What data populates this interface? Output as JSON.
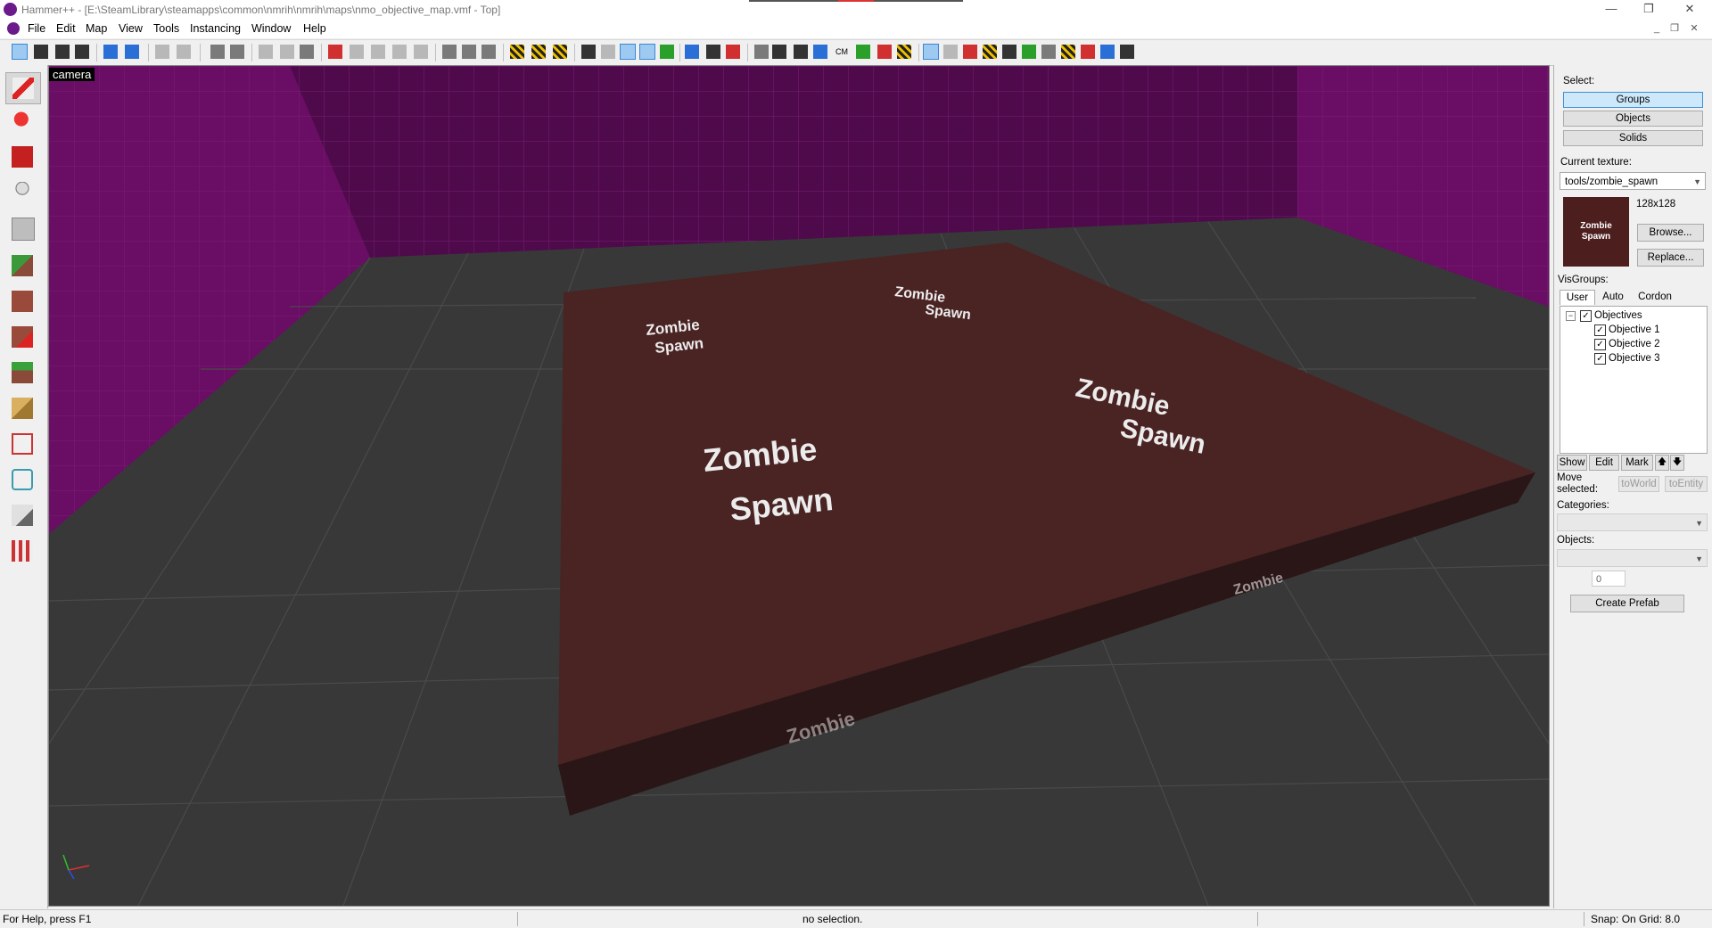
{
  "window": {
    "title": "Hammer++ - [E:\\SteamLibrary\\steamapps\\common\\nmrih\\nmrih\\maps\\nmo_objective_map.vmf - Top]",
    "minimize": "—",
    "restore": "❐",
    "close": "✕"
  },
  "menu": {
    "items": [
      "File",
      "Edit",
      "Map",
      "View",
      "Tools",
      "Instancing",
      "Window",
      "Help"
    ],
    "mdi_minimize": "_",
    "mdi_restore": "❐",
    "mdi_close": "✕"
  },
  "toolbar": {
    "cm_label": "CM"
  },
  "viewport": {
    "label": "camera",
    "decal_word_1": "Zombie",
    "decal_word_2": "Spawn",
    "side_word": "Zombie"
  },
  "panel": {
    "select_label": "Select:",
    "select_buttons": [
      "Groups",
      "Objects",
      "Solids"
    ],
    "current_texture_label": "Current texture:",
    "current_texture_value": "tools/zombie_spawn",
    "texture_size": "128x128",
    "browse_button": "Browse...",
    "replace_button": "Replace...",
    "texture_preview_line1": "Zombie",
    "texture_preview_line2": "Spawn",
    "visgroups_label": "VisGroups:",
    "tabs": [
      "User",
      "Auto",
      "Cordon"
    ],
    "tree_expander": "−",
    "tree": {
      "root": "Objectives",
      "children": [
        "Objective 1",
        "Objective 2",
        "Objective 3"
      ]
    },
    "check_mark": "✓",
    "show_button": "Show",
    "edit_button": "Edit",
    "mark_button": "Mark",
    "up_arrow": "🡅",
    "down_arrow": "🡇",
    "move_selected_label": "Move selected:",
    "to_world_button": "toWorld",
    "to_entity_button": "toEntity",
    "categories_label": "Categories:",
    "objects_label": "Objects:",
    "spin_value": "0",
    "create_prefab_button": "Create Prefab"
  },
  "status": {
    "help": "For Help, press F1",
    "selection": "no selection.",
    "snap": "Snap: On Grid: 8.0"
  },
  "colors": {
    "wall": "#5a0a55",
    "floor": "#3a3a3a",
    "block_top": "#4a2323",
    "accent_blue": "#3a87d8"
  }
}
